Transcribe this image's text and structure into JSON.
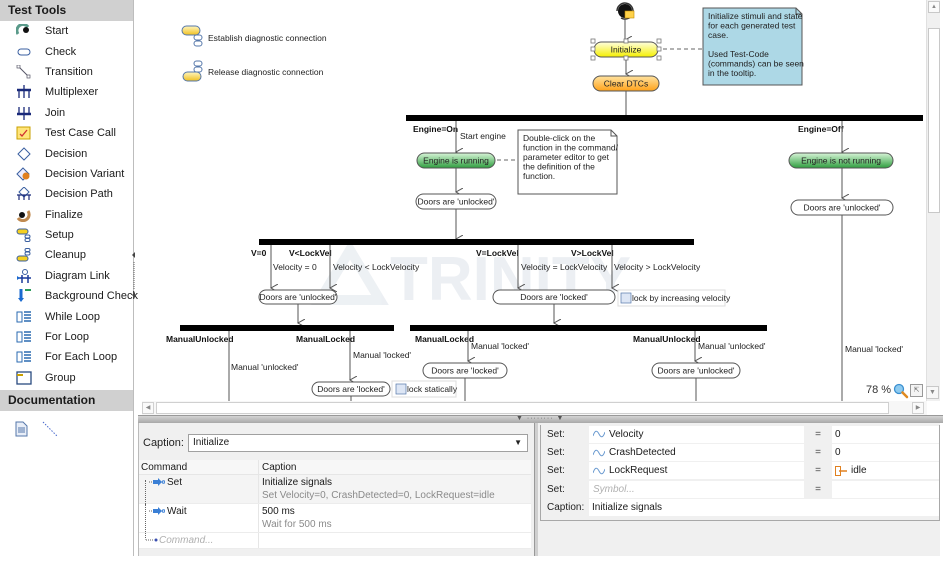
{
  "sidebar": {
    "test_tools_header": "Test Tools",
    "items": [
      {
        "label": "Start",
        "icon": "start-icon"
      },
      {
        "label": "Check",
        "icon": "check-icon"
      },
      {
        "label": "Transition",
        "icon": "transition-icon"
      },
      {
        "label": "Multiplexer",
        "icon": "multiplexer-icon"
      },
      {
        "label": "Join",
        "icon": "join-icon"
      },
      {
        "label": "Test Case Call",
        "icon": "test-case-call-icon"
      },
      {
        "label": "Decision",
        "icon": "decision-icon"
      },
      {
        "label": "Decision Variant",
        "icon": "decision-variant-icon"
      },
      {
        "label": "Decision Path",
        "icon": "decision-path-icon"
      },
      {
        "label": "Finalize",
        "icon": "finalize-icon"
      },
      {
        "label": "Setup",
        "icon": "setup-icon"
      },
      {
        "label": "Cleanup",
        "icon": "cleanup-icon"
      },
      {
        "label": "Diagram Link",
        "icon": "diagram-link-icon"
      },
      {
        "label": "Background Check",
        "icon": "background-check-icon"
      },
      {
        "label": "While Loop",
        "icon": "while-loop-icon"
      },
      {
        "label": "For Loop",
        "icon": "for-loop-icon"
      },
      {
        "label": "For Each Loop",
        "icon": "for-each-loop-icon"
      },
      {
        "label": "Group",
        "icon": "group-icon"
      }
    ],
    "documentation_header": "Documentation",
    "doc_tools": [
      "note-icon",
      "note-link-icon"
    ]
  },
  "diagram": {
    "setup_label": "Establish diagnostic connection",
    "cleanup_label": "Release diagnostic connection",
    "initialize": "Initialize",
    "clear_dtcs": "Clear DTCs",
    "note1": [
      "Initialize stimuli and state",
      "for each generated test",
      "case.",
      "",
      "Used Test-Code",
      "(commands) can be seen",
      "in the tooltip."
    ],
    "note2": [
      "Double-click on the",
      "function in the command/",
      "parameter editor to get",
      "the definition of the",
      "function."
    ],
    "engine_on": "Engine=On",
    "engine_off": "Engine=Off",
    "start_engine": "Start engine",
    "engine_running": "Engine is running",
    "engine_not_running": "Engine is not running",
    "doors_unlocked": "Doors are 'unlocked'",
    "doors_locked": "Doors are 'locked'",
    "v0": "V=0",
    "v_lt": "V<LockVel",
    "v_eq": "V=LockVel",
    "v_gt": "V>LockVel",
    "vel0": "Velocity = 0",
    "vel_lt": "Velocity < LockVelocity",
    "vel_eq": "Velocity = LockVelocity",
    "vel_gt": "Velocity > LockVelocity",
    "lock_increasing": "lock by increasing velocity",
    "lock_statically": "lock statically",
    "manual_unlocked_bold": "ManualUnlocked",
    "manual_locked_bold": "ManualLocked",
    "manual_locked": "Manual 'locked'",
    "manual_unlocked": "Manual 'unlocked'",
    "watermark": "TRINITY",
    "zoom_level": "78 %"
  },
  "command_editor": {
    "caption_label": "Caption:",
    "caption_value": "Initialize",
    "columns": [
      "Command",
      "Caption"
    ],
    "rows": [
      {
        "command": "Set",
        "caption": "Initialize signals",
        "detail": "Set Velocity=0, CrashDetected=0, LockRequest=idle"
      },
      {
        "command": "Wait",
        "caption": "500 ms",
        "detail": "Wait for 500 ms"
      }
    ],
    "new_command_placeholder": "Command..."
  },
  "property_editor": {
    "rows": [
      {
        "label": "Set:",
        "symbol": "Velocity",
        "eq": "=",
        "value": "0"
      },
      {
        "label": "Set:",
        "symbol": "CrashDetected",
        "eq": "=",
        "value": "0"
      },
      {
        "label": "Set:",
        "symbol": "LockRequest",
        "eq": "=",
        "value": "idle"
      }
    ],
    "new_row": {
      "label": "Set:",
      "placeholder": "Symbol...",
      "eq": "="
    },
    "caption_label": "Caption:",
    "caption_value": "Initialize signals"
  },
  "colors": {
    "note_fill": "#add8e6",
    "initialize_fill": "#ffff66",
    "clear_dtcs_fill": "#ffb433",
    "engine_state_fill": "#4caf50",
    "bar_color": "#000000",
    "section_header_bg": "#d0d0d0"
  }
}
